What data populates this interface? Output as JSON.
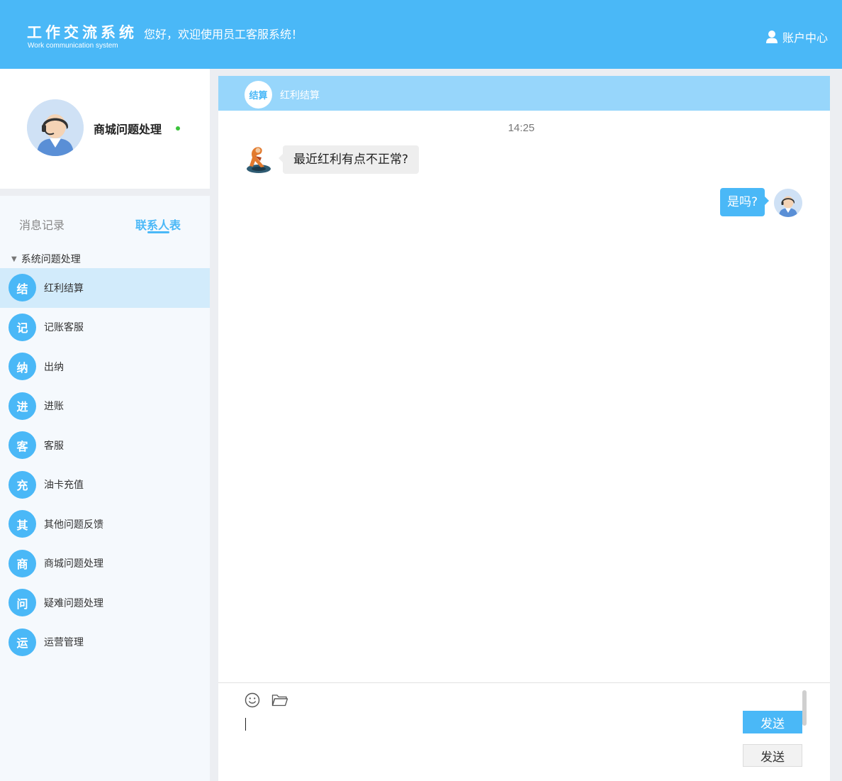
{
  "header": {
    "title": "工作交流系统",
    "subtitle": "Work communication system",
    "welcome": "您好，欢迎使用员工客服系统！",
    "account_label": "账户中心",
    "account_icon": "user-icon",
    "color": "#4ab8f7"
  },
  "profile": {
    "name": "商城问题处理",
    "status": "online",
    "status_color": "#3bc33b"
  },
  "sidebar": {
    "tabs": [
      {
        "label": "消息记录",
        "active": false
      },
      {
        "label": "联系人表",
        "active": true
      }
    ],
    "group": "系统问题处理",
    "contacts": [
      {
        "badge": "结",
        "label": "红利结算",
        "active": true
      },
      {
        "badge": "记",
        "label": "记账客服"
      },
      {
        "badge": "纳",
        "label": "出纳"
      },
      {
        "badge": "进",
        "label": "进账"
      },
      {
        "badge": "客",
        "label": "客服"
      },
      {
        "badge": "充",
        "label": "油卡充值"
      },
      {
        "badge": "其",
        "label": "其他问题反馈"
      },
      {
        "badge": "商",
        "label": "商城问题处理"
      },
      {
        "badge": "问",
        "label": "疑难问题处理"
      },
      {
        "badge": "运",
        "label": "运营管理"
      }
    ]
  },
  "chat": {
    "header_badge": "结算",
    "header_title": "红利结算",
    "timestamp": "14:25",
    "messages": [
      {
        "side": "left",
        "text": "最近红利有点不正常?"
      },
      {
        "side": "right",
        "text": "是吗?"
      }
    ]
  },
  "composer": {
    "value": "",
    "emoji_icon": "smile-icon",
    "folder_icon": "folder-icon",
    "send_primary": "发送",
    "send_secondary": "发送"
  }
}
